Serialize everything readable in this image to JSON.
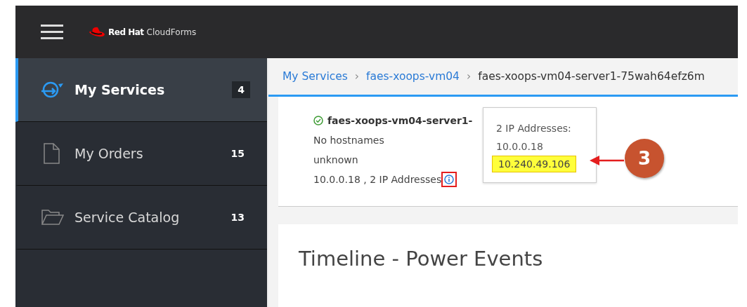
{
  "header": {
    "brand": "Red Hat",
    "product": "CloudForms"
  },
  "sidebar": {
    "items": [
      {
        "label": "My Services",
        "count": "4",
        "kind": "services",
        "selected": true
      },
      {
        "label": "My Orders",
        "count": "15",
        "kind": "orders",
        "selected": false
      },
      {
        "label": "Service Catalog",
        "count": "13",
        "kind": "catalog",
        "selected": false
      }
    ]
  },
  "breadcrumb": {
    "separator": "›",
    "items": [
      {
        "label": "My Services",
        "link": true
      },
      {
        "label": "faes-xoops-vm04",
        "link": true
      },
      {
        "label": "faes-xoops-vm04-server1-75wah64efz6m",
        "link": false
      }
    ]
  },
  "server": {
    "name": "faes-xoops-vm04-server1-",
    "hostnames": "No hostnames",
    "os": "unknown",
    "ips": "10.0.0.18 , 2 IP Addresses"
  },
  "tooltip": {
    "title": "2 IP Addresses:",
    "addresses": [
      {
        "text": "10.0.0.18",
        "highlighted": false
      },
      {
        "text": "10.240.49.106",
        "highlighted": true
      }
    ]
  },
  "annotation": {
    "number": "3"
  },
  "timeline": {
    "title": "Timeline - Power Events"
  }
}
